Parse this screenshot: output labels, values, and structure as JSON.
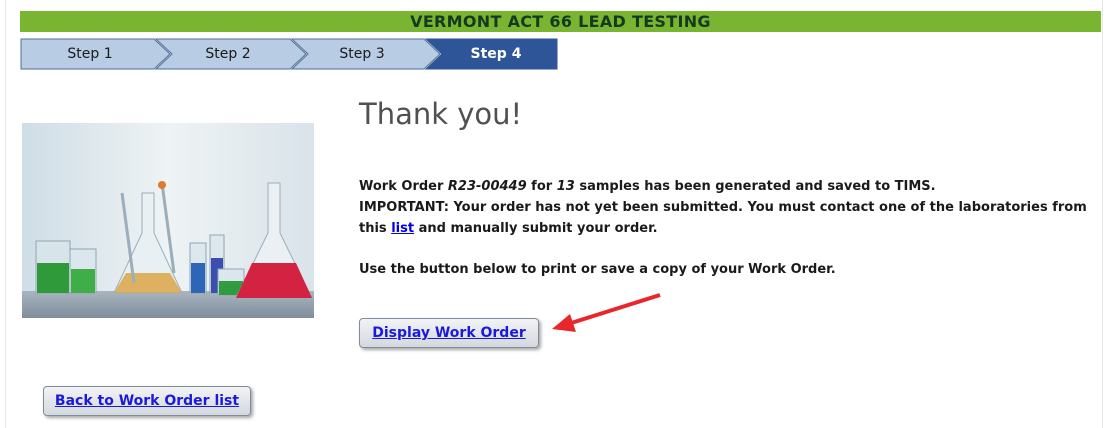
{
  "banner": {
    "title": "VERMONT ACT 66 LEAD TESTING"
  },
  "steps": [
    {
      "label": "Step 1",
      "active": false
    },
    {
      "label": "Step 2",
      "active": false
    },
    {
      "label": "Step 3",
      "active": false
    },
    {
      "label": "Step 4",
      "active": true
    }
  ],
  "colors": {
    "banner": "#79b530",
    "step_inactive": "#b8cce4",
    "step_active": "#2e5597",
    "link": "#0000ee",
    "arrow": "#e8262b"
  },
  "main": {
    "heading": "Thank you!",
    "work_order_prefix": "Work Order ",
    "work_order_id": "R23-00449",
    "for_text": " for ",
    "sample_count": "13",
    "generated_text": " samples has been generated and saved to TIMS.",
    "important_text": "IMPORTANT: Your order has not yet been submitted. You must contact one of the laboratories from this ",
    "list_link": "list",
    "important_end": " and manually submit your order.",
    "print_text": "Use the button below to print or save a copy of your Work Order.",
    "display_button": "Display Work Order",
    "back_button": "Back to Work Order list"
  },
  "icons": [
    "red-arrow-icon"
  ],
  "image": {
    "name": "laboratory-glassware-photo"
  }
}
